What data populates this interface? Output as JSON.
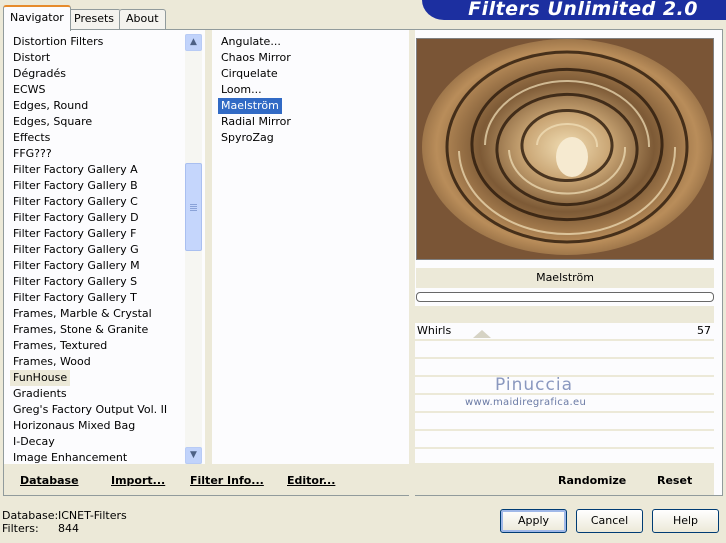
{
  "tabs": [
    "Navigator",
    "Presets",
    "About"
  ],
  "banner_title": "Filters Unlimited 2.0",
  "categories": [
    "Distortion Filters",
    "Distort",
    "Dégradés",
    "ECWS",
    "Edges, Round",
    "Edges, Square",
    "Effects",
    "FFG???",
    "Filter Factory Gallery A",
    "Filter Factory Gallery B",
    "Filter Factory Gallery C",
    "Filter Factory Gallery D",
    "Filter Factory Gallery F",
    "Filter Factory Gallery G",
    "Filter Factory Gallery M",
    "Filter Factory Gallery S",
    "Filter Factory Gallery T",
    "Frames, Marble & Crystal",
    "Frames, Stone & Granite",
    "Frames, Textured",
    "Frames, Wood",
    "FunHouse",
    "Gradients",
    "Greg's Factory Output Vol. II",
    "Horizonaus Mixed Bag",
    "I-Decay",
    "Image Enhancement"
  ],
  "selected_category": "FunHouse",
  "filters": [
    "Angulate...",
    "Chaos Mirror",
    "Cirquelate",
    "Loom...",
    "Maelström",
    "Radial Mirror",
    "SpyroZag"
  ],
  "selected_filter": "Maelström",
  "left_buttons": {
    "database": "Database",
    "import": "Import...",
    "filter_info": "Filter Info...",
    "editor": "Editor..."
  },
  "preview": {
    "filter_name": "Maelström",
    "progress": 0
  },
  "params": [
    {
      "label": "Whirls",
      "value": "57"
    }
  ],
  "right_buttons": {
    "randomize": "Randomize",
    "reset": "Reset"
  },
  "watermark": {
    "line1": "Pinuccia",
    "line2": "www.maidiregrafica.eu"
  },
  "status": {
    "database_label": "Database:",
    "database_value": "ICNET-Filters",
    "filters_label": "Filters:",
    "filters_value": "844"
  },
  "dialog_buttons": {
    "apply": "Apply",
    "cancel": "Cancel",
    "help": "Help"
  },
  "colors": {
    "selection": "#316ac5",
    "banner": "#1c2fa0",
    "accent_tab": "#e68b2c"
  }
}
